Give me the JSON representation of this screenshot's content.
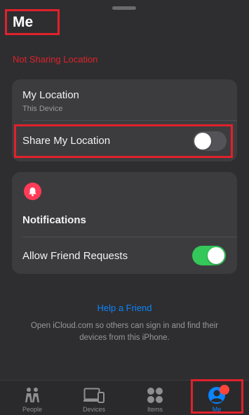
{
  "header": {
    "title": "Me"
  },
  "status": {
    "text": "Not Sharing Location"
  },
  "location_card": {
    "title": "My Location",
    "subtitle": "This Device",
    "share_label": "Share My Location",
    "share_enabled": false
  },
  "notifications_card": {
    "icon": "bell-icon",
    "title": "Notifications",
    "friend_requests_label": "Allow Friend Requests",
    "friend_requests_enabled": true
  },
  "help": {
    "link": "Help a Friend",
    "description": "Open iCloud.com so others can sign in and find their devices from this iPhone."
  },
  "tabs": [
    {
      "label": "People",
      "icon": "people-icon",
      "active": false
    },
    {
      "label": "Devices",
      "icon": "devices-icon",
      "active": false
    },
    {
      "label": "Items",
      "icon": "items-icon",
      "active": false
    },
    {
      "label": "Me",
      "icon": "me-icon",
      "active": true
    }
  ],
  "colors": {
    "accent": "#0a84ff",
    "toggle_on": "#34c759",
    "highlight": "#e0212b",
    "badge": "#ff3b57"
  }
}
